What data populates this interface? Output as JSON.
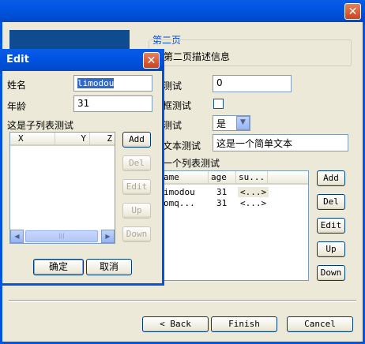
{
  "wizard": {
    "close_label": "✕",
    "page_group_title": "第二页",
    "page_description": "第二页描述信息",
    "fields": {
      "int_label": "测试",
      "int_value": "0",
      "checkbox_label": "框测试",
      "combo_label": "测试",
      "combo_value": "是",
      "text_label": "文本测试",
      "text_value": "这是一个简单文本",
      "list_label": "一个列表测试"
    },
    "table": {
      "columns": [
        "ame",
        "age",
        "su..."
      ],
      "rows": [
        {
          "name": "imodou",
          "age": "31",
          "sub": "<...>"
        },
        {
          "name": "omq...",
          "age": "31",
          "sub": "<...>"
        }
      ]
    },
    "side_buttons": [
      "Add",
      "Del",
      "Edit",
      "Up",
      "Down"
    ],
    "nav": {
      "back": "< Back",
      "finish": "Finish",
      "cancel": "Cancel"
    }
  },
  "edit_dialog": {
    "title": "Edit",
    "close_label": "✕",
    "name_label": "姓名",
    "name_value": "limodou",
    "age_label": "年龄",
    "age_value": "31",
    "sublist_label": "这是子列表测试",
    "columns": [
      "X",
      "Y",
      "Z"
    ],
    "buttons": [
      "Add",
      "Del",
      "Edit",
      "Up",
      "Down"
    ],
    "scroll_thumb_glyph": "|||",
    "ok": "确定",
    "cancel": "取消"
  }
}
